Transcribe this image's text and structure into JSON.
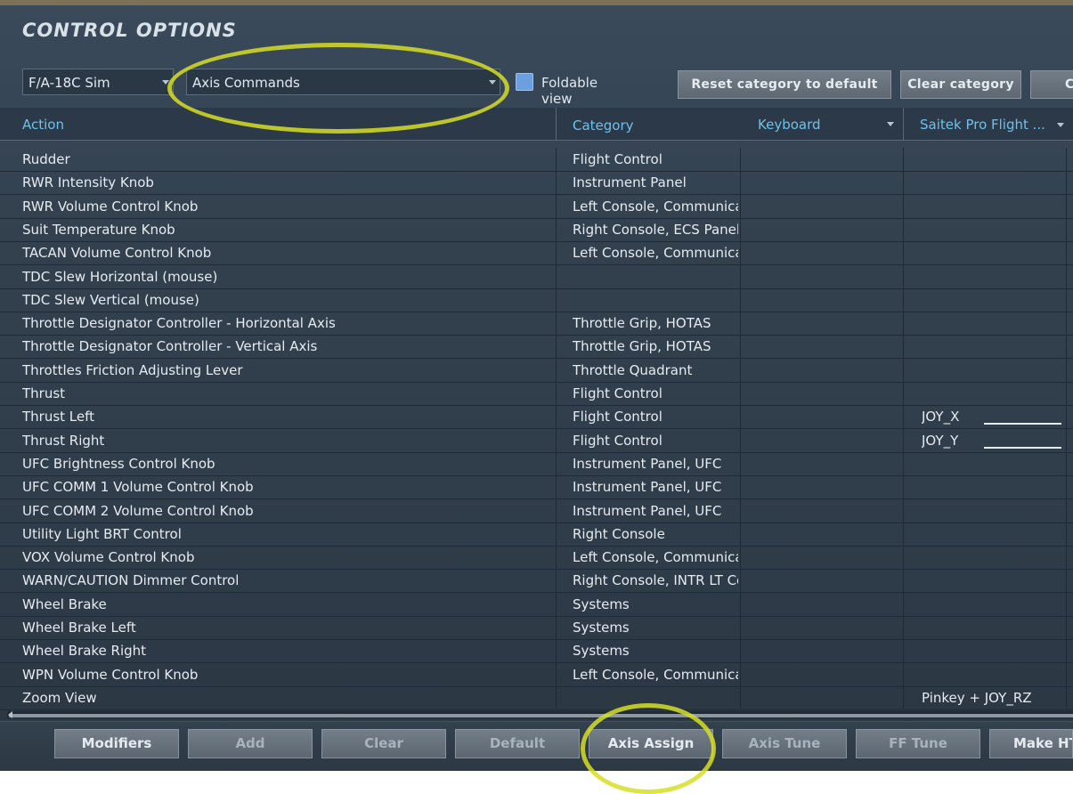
{
  "window": {
    "title": "CONTROL OPTIONS"
  },
  "toolbar": {
    "aircraft_select": "F/A-18C Sim",
    "category_select": "Axis Commands",
    "foldable_view_label": "Foldable view",
    "reset_category_label": "Reset category to default",
    "clear_category_label": "Clear category",
    "cut_button_label": "C"
  },
  "table": {
    "columns": [
      "Action",
      "Category",
      "Keyboard",
      "Saitek Pro Flight ..."
    ],
    "rows": [
      {
        "action": "Rudder",
        "category": "Flight Control",
        "saitek": ""
      },
      {
        "action": "RWR Intensity Knob",
        "category": "Instrument Panel",
        "saitek": ""
      },
      {
        "action": "RWR Volume Control Knob",
        "category": "Left Console, Communica",
        "saitek": ""
      },
      {
        "action": "Suit Temperature Knob",
        "category": "Right Console, ECS Panel",
        "saitek": ""
      },
      {
        "action": "TACAN Volume Control Knob",
        "category": "Left Console, Communica",
        "saitek": ""
      },
      {
        "action": "TDC Slew Horizontal (mouse)",
        "category": "",
        "saitek": ""
      },
      {
        "action": "TDC Slew Vertical (mouse)",
        "category": "",
        "saitek": ""
      },
      {
        "action": "Throttle Designator Controller - Horizontal Axis",
        "category": "Throttle Grip, HOTAS",
        "saitek": ""
      },
      {
        "action": "Throttle Designator Controller - Vertical Axis",
        "category": "Throttle Grip, HOTAS",
        "saitek": ""
      },
      {
        "action": "Throttles Friction Adjusting Lever",
        "category": "Throttle Quadrant",
        "saitek": ""
      },
      {
        "action": "Thrust",
        "category": "Flight Control",
        "saitek": ""
      },
      {
        "action": "Thrust Left",
        "category": "Flight Control",
        "saitek": "JOY_X"
      },
      {
        "action": "Thrust Right",
        "category": "Flight Control",
        "saitek": "JOY_Y"
      },
      {
        "action": "UFC Brightness Control Knob",
        "category": "Instrument Panel, UFC",
        "saitek": ""
      },
      {
        "action": "UFC COMM 1 Volume Control Knob",
        "category": "Instrument Panel, UFC",
        "saitek": ""
      },
      {
        "action": "UFC COMM 2 Volume Control Knob",
        "category": "Instrument Panel, UFC",
        "saitek": ""
      },
      {
        "action": "Utility Light BRT Control",
        "category": "Right Console",
        "saitek": ""
      },
      {
        "action": "VOX Volume Control Knob",
        "category": "Left Console, Communica",
        "saitek": ""
      },
      {
        "action": "WARN/CAUTION Dimmer Control",
        "category": "Right Console, INTR LT Cc",
        "saitek": ""
      },
      {
        "action": "Wheel Brake",
        "category": "Systems",
        "saitek": ""
      },
      {
        "action": "Wheel Brake Left",
        "category": "Systems",
        "saitek": ""
      },
      {
        "action": "Wheel Brake Right",
        "category": "Systems",
        "saitek": ""
      },
      {
        "action": "WPN Volume Control Knob",
        "category": "Left Console, Communica",
        "saitek": ""
      },
      {
        "action": "Zoom View",
        "category": "",
        "saitek": "Pinkey + JOY_RZ"
      }
    ]
  },
  "bottom_buttons": [
    "Modifiers",
    "Add",
    "Clear",
    "Default",
    "Axis Assign",
    "Axis Tune",
    "FF Tune",
    "Make HTML"
  ],
  "colors": {
    "header_text": "#6fc1ea",
    "checkbox": "#6b9fe0",
    "highlight": "#d6de24"
  }
}
